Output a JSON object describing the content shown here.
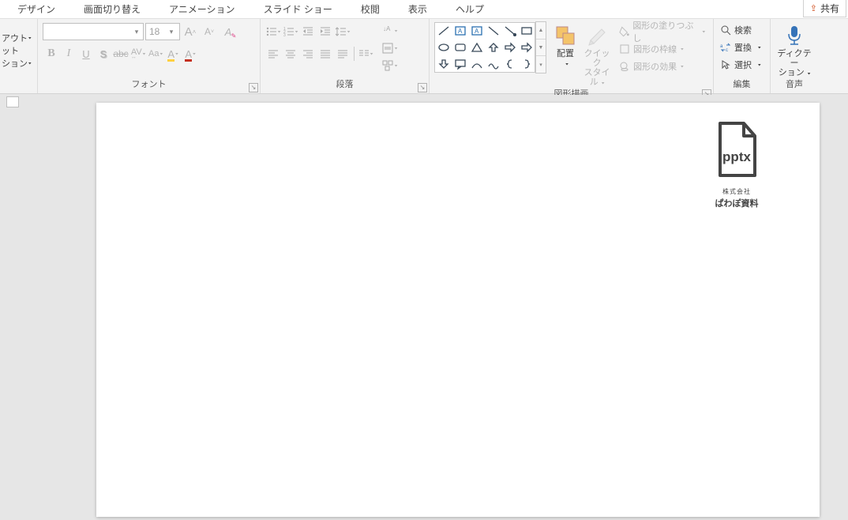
{
  "tabs": {
    "design": "デザイン",
    "transitions": "画面切り替え",
    "animations": "アニメーション",
    "slideshow": "スライド ショー",
    "review": "校閲",
    "view": "表示",
    "help": "ヘルプ"
  },
  "share": {
    "label": "共有"
  },
  "left_group": {
    "layout": "アウト",
    "reset": "ット",
    "section": "ション",
    "label": ""
  },
  "font": {
    "name_value": "",
    "size_value": "18",
    "label": "フォント",
    "bold": "B",
    "italic": "I",
    "underline": "U",
    "shadow": "S",
    "strike": "abc",
    "spacing": "AV",
    "case": "Aa",
    "grow": "A",
    "shrink": "A",
    "clear": "A",
    "highlight": "A",
    "fontcolor": "A"
  },
  "paragraph": {
    "label": "段落"
  },
  "drawing": {
    "label": "図形描画",
    "arrange": "配置",
    "quick_styles_1": "クイック",
    "quick_styles_2": "スタイル",
    "fill": "図形の塗りつぶし",
    "outline": "図形の枠線",
    "effects": "図形の効果"
  },
  "editing": {
    "label": "編集",
    "find": "検索",
    "replace": "置換",
    "select": "選択"
  },
  "voice": {
    "label": "音声",
    "dictate_1": "ディクテー",
    "dictate_2": "ション"
  },
  "slide": {
    "logo_ext": "pptx",
    "logo_sub": "株式会社",
    "logo_main": "ぱわぽ資料"
  }
}
